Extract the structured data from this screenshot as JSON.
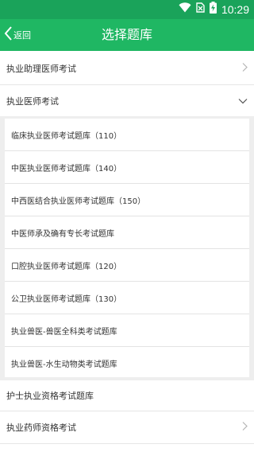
{
  "status": {
    "time": "10:29",
    "icons": [
      "wifi-icon",
      "no-sim-icon",
      "battery-charging-icon"
    ]
  },
  "header": {
    "back_label": "返回",
    "title": "选择题库"
  },
  "list": {
    "items": [
      {
        "label": "执业助理医师考试",
        "icon": "chevron-right-icon"
      },
      {
        "label": "执业医师考试",
        "icon": "chevron-down-icon"
      },
      {
        "label": "护士执业资格考试题库"
      },
      {
        "label": "执业药师资格考试",
        "icon": "chevron-right-icon"
      }
    ],
    "sub_items": [
      "临床执业医师考试题库（110）",
      "中医执业医师考试题库（140）",
      "中西医结合执业医师考试题库（150）",
      "中医师承及确有专长考试题库",
      "口腔执业医师考试题库（120）",
      "公卫执业医师考试题库（130）",
      "执业兽医-兽医全科类考试题库",
      "执业兽医-水生动物类考试题库"
    ]
  },
  "colors": {
    "status_bar": "#1aa35a",
    "app_bar": "#1fb763",
    "background": "#ffffff",
    "panel": "#eeeeee"
  }
}
